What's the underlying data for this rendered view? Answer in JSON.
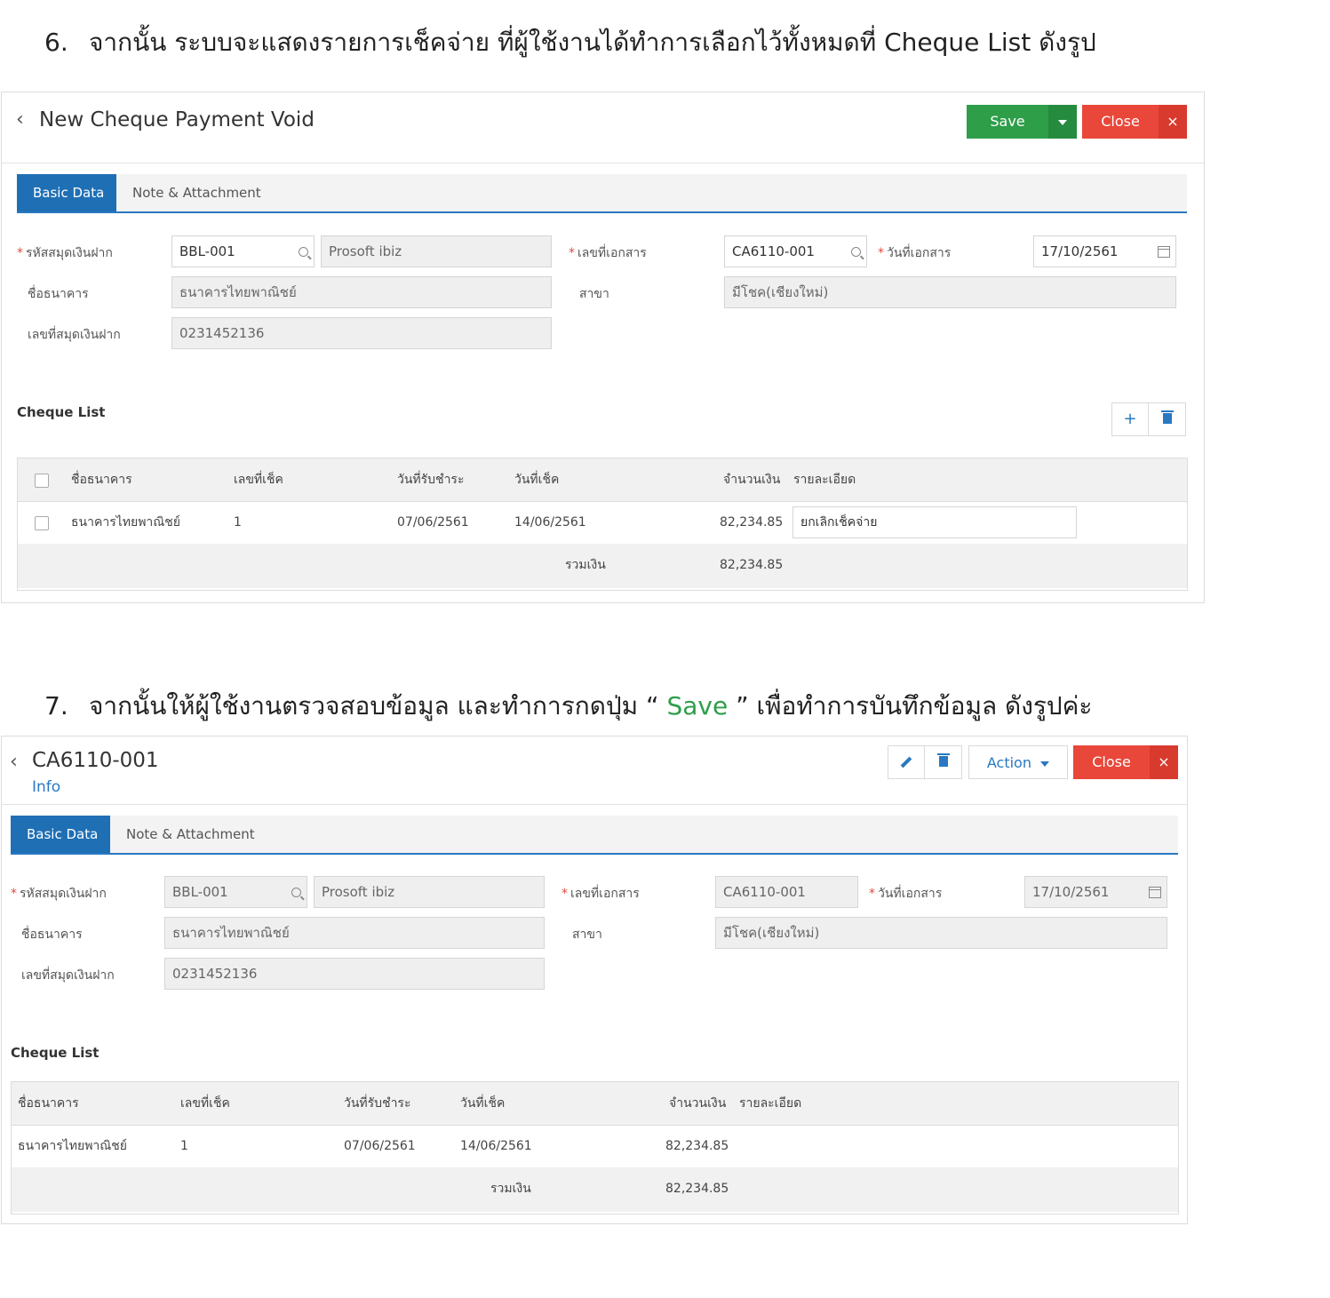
{
  "step6": {
    "number": "6.",
    "text": "จากนั้น ระบบจะแสดงรายการเช็คจ่าย ที่ผู้ใช้งานได้ทำการเลือกไว้ทั้งหมดที่ Cheque List ดังรูป"
  },
  "step7": {
    "number": "7.",
    "text_before": "จากนั้นให้ผู้ใช้งานตรวจสอบข้อมูล และทำการกดปุ่ม “ ",
    "save_word": "Save",
    "text_after": " ” เพื่อทำการบันทึกข้อมูล ดังรูปค่ะ"
  },
  "colors": {
    "green": "#2e9e49",
    "red": "#e8473a",
    "blue": "#1f6fb5"
  },
  "screen1": {
    "title": "New Cheque Payment Void",
    "save_label": "Save",
    "close_label": "Close",
    "close_x": "×",
    "tabs": [
      "Basic Data",
      "Note & Attachment"
    ],
    "fields": {
      "passbook_label": "รหัสสมุดเงินฝาก",
      "passbook_code": "BBL-001",
      "passbook_name": "Prosoft ibiz",
      "bank_label": "ชื่อธนาคาร",
      "bank_value": "ธนาคารไทยพาณิชย์",
      "account_label": "เลขที่สมุดเงินฝาก",
      "account_value": "0231452136",
      "doc_no_label": "เลขที่เอกสาร",
      "doc_no_value": "CA6110-001",
      "doc_date_label": "วันที่เอกสาร",
      "doc_date_value": "17/10/2561",
      "branch_label": "สาขา",
      "branch_value": "มีโชค(เชียงใหม่)"
    },
    "cheque_list_title": "Cheque List",
    "columns": [
      "ชื่อธนาคาร",
      "เลขที่เช็ค",
      "วันที่รับชำระ",
      "วันที่เช็ค",
      "จำนวนเงิน",
      "รายละเอียด"
    ],
    "row": {
      "bank": "ธนาคารไทยพาณิชย์",
      "cheque_no": "1",
      "receive_date": "07/06/2561",
      "cheque_date": "14/06/2561",
      "amount": "82,234.85",
      "detail": "ยกเลิกเช็คจ่าย"
    },
    "total_label": "รวมเงิน",
    "total_value": "82,234.85"
  },
  "screen2": {
    "title": "CA6110-001",
    "subtitle": "Info",
    "action_label": "Action",
    "close_label": "Close",
    "close_x": "×",
    "tabs": [
      "Basic Data",
      "Note & Attachment"
    ],
    "fields": {
      "passbook_label": "รหัสสมุดเงินฝาก",
      "passbook_code": "BBL-001",
      "passbook_name": "Prosoft ibiz",
      "bank_label": "ชื่อธนาคาร",
      "bank_value": "ธนาคารไทยพาณิชย์",
      "account_label": "เลขที่สมุดเงินฝาก",
      "account_value": "0231452136",
      "doc_no_label": "เลขที่เอกสาร",
      "doc_no_value": "CA6110-001",
      "doc_date_label": "วันที่เอกสาร",
      "doc_date_value": "17/10/2561",
      "branch_label": "สาขา",
      "branch_value": "มีโชค(เชียงใหม่)"
    },
    "cheque_list_title": "Cheque List",
    "columns": [
      "ชื่อธนาคาร",
      "เลขที่เช็ค",
      "วันที่รับชำระ",
      "วันที่เช็ค",
      "จำนวนเงิน",
      "รายละเอียด"
    ],
    "row": {
      "bank": "ธนาคารไทยพาณิชย์",
      "cheque_no": "1",
      "receive_date": "07/06/2561",
      "cheque_date": "14/06/2561",
      "amount": "82,234.85"
    },
    "total_label": "รวมเงิน",
    "total_value": "82,234.85"
  }
}
